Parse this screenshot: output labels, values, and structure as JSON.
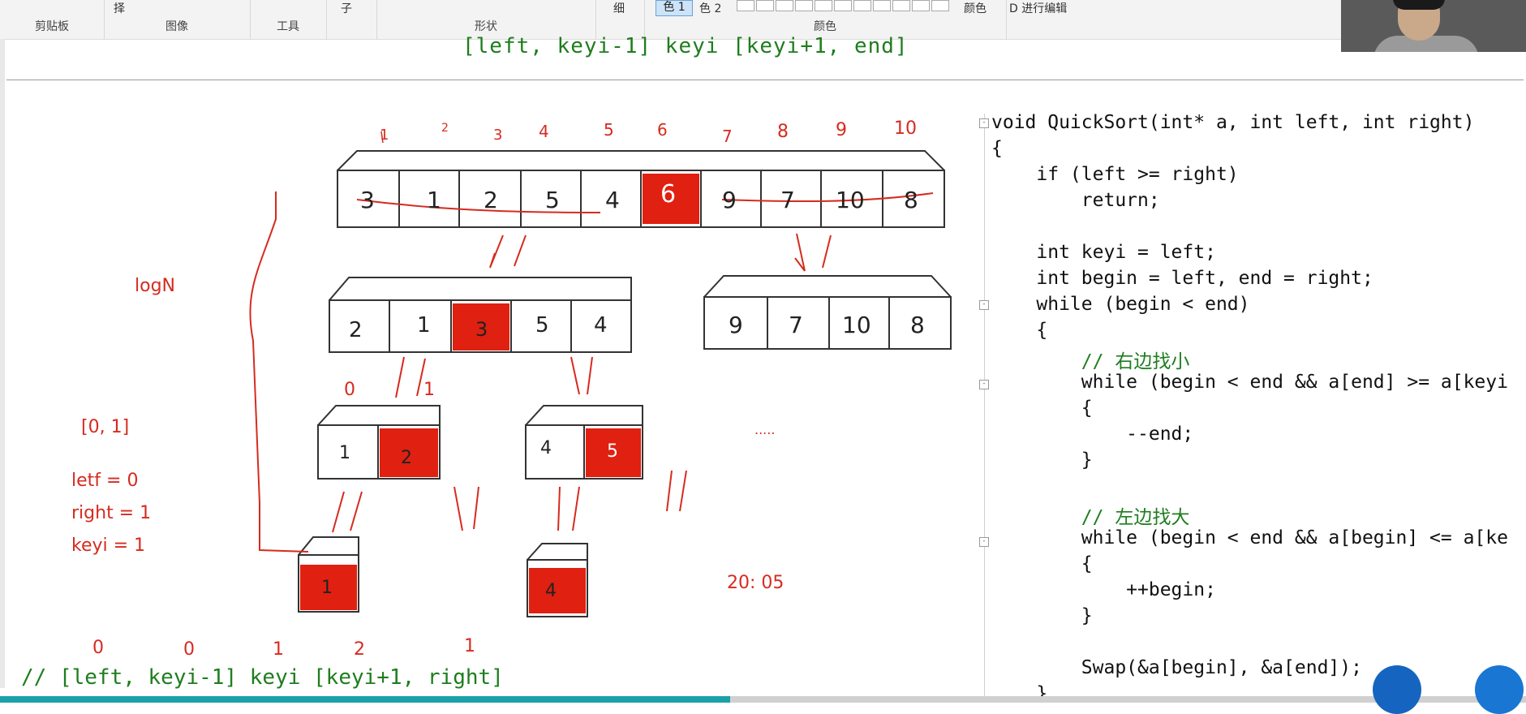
{
  "ribbon": {
    "groups": [
      "剪贴板",
      "图像",
      "工具",
      "形状",
      "颜色"
    ],
    "fragments": {
      "select": "择",
      "shape_sel": "子",
      "thin": "细",
      "color1": "色 1",
      "color2": "色 2",
      "palette": "颜色",
      "edit3d": "D 进行编辑"
    }
  },
  "doc": {
    "top_code": "[left, keyi-1] keyi [keyi+1, end]",
    "bottom_code": "// [left, keyi-1] keyi [keyi+1, right]",
    "top_indices": [
      "1",
      "2",
      "3",
      "4",
      "5",
      "6",
      "7",
      "8",
      "9",
      "10"
    ],
    "row1": [
      "3",
      "1",
      "2",
      "5",
      "4",
      "6",
      "9",
      "7",
      "10",
      "8"
    ],
    "row2_left": [
      "2",
      "1",
      "3",
      "5",
      "4"
    ],
    "row2_right": [
      "9",
      "7",
      "10",
      "8"
    ],
    "row3_a": [
      "1",
      "2"
    ],
    "row3_b": [
      "4",
      "5"
    ],
    "row4_a": "1",
    "row4_b": "4",
    "labels": {
      "logn": "logN",
      "range": "[0, 1]",
      "left_eq": "letf = 0",
      "right_eq": "right = 1",
      "keyi_eq": "keyi = 1",
      "idx0": "0",
      "idx1": "1",
      "dots": ".....",
      "time": "20: 05",
      "bottom_nums": [
        "0",
        "0",
        "1",
        "2",
        "1"
      ]
    }
  },
  "code": {
    "lines": [
      "void QuickSort(int* a, int left, int right)",
      "{",
      "    if (left >= right)",
      "        return;",
      "",
      "    int keyi = left;",
      "    int begin = left, end = right;",
      "    while (begin < end)",
      "    {",
      "        // 右边找小",
      "        while (begin < end && a[end] >= a[keyi",
      "        {",
      "            --end;",
      "        }",
      "",
      "        // 左边找大",
      "        while (begin < end && a[begin] <= a[ke",
      "        {",
      "            ++begin;",
      "        }",
      "",
      "        Swap(&a[begin], &a[end]);",
      "    }"
    ]
  },
  "colors": {
    "accent_red": "#d62b1f",
    "comment_green": "#1e7d1e",
    "keyword_blue": "#1010b0"
  }
}
